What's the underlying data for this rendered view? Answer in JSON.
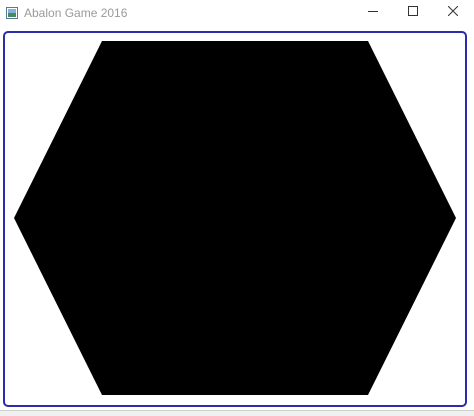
{
  "window": {
    "title": "Abalon Game 2016",
    "app_icon": "application-icon",
    "controls": {
      "minimize_icon": "minimize-icon",
      "maximize_icon": "maximize-icon",
      "close_icon": "close-icon"
    }
  },
  "board": {
    "shape": "hexagon",
    "fill_color": "#000000",
    "border_color": "#2b2bab"
  }
}
